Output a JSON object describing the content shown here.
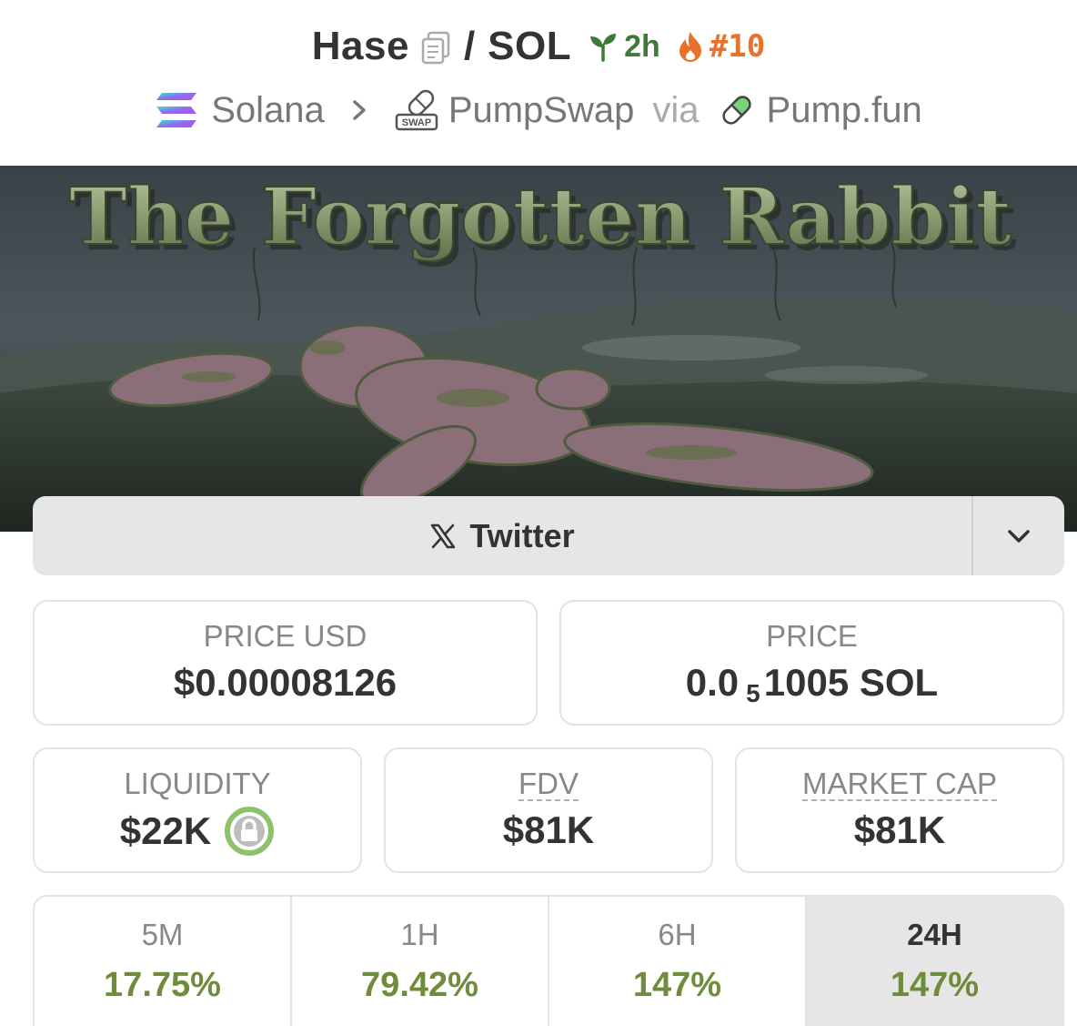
{
  "header": {
    "base_token": "Hase",
    "separator": "/",
    "quote_token": "SOL",
    "age": "2h",
    "rank": "#10",
    "copy_icon": "copy-icon",
    "age_icon": "sprout-icon",
    "rank_icon": "flame-icon",
    "colors": {
      "age": "#3e7a3a",
      "rank": "#e8722a"
    }
  },
  "breadcrumb": {
    "chain": "Solana",
    "dex": "PumpSwap",
    "dex_badge": "SWAP",
    "via": "via",
    "launchpad": "Pump.fun"
  },
  "banner": {
    "title": "The Forgotten Rabbit"
  },
  "social": {
    "label": "Twitter",
    "icon": "x-icon",
    "toggle_icon": "chevron-down-icon"
  },
  "stats": {
    "price_usd": {
      "label": "PRICE USD",
      "value": "$0.00008126"
    },
    "price_native": {
      "label": "PRICE",
      "prefix": "0.0",
      "zeros": "5",
      "suffix": "1005 SOL"
    },
    "liquidity": {
      "label": "LIQUIDITY",
      "value": "$22K",
      "locked_icon": "lock-icon"
    },
    "fdv": {
      "label": "FDV",
      "value": "$81K"
    },
    "market_cap": {
      "label": "MARKET CAP",
      "value": "$81K"
    }
  },
  "timeframes": [
    {
      "label": "5M",
      "change": "17.75%",
      "active": false
    },
    {
      "label": "1H",
      "change": "79.42%",
      "active": false
    },
    {
      "label": "6H",
      "change": "147%",
      "active": false
    },
    {
      "label": "24H",
      "change": "147%",
      "active": true
    }
  ],
  "colors": {
    "positive": "#6f8c3a",
    "accent_lock": "#8dc26a"
  }
}
